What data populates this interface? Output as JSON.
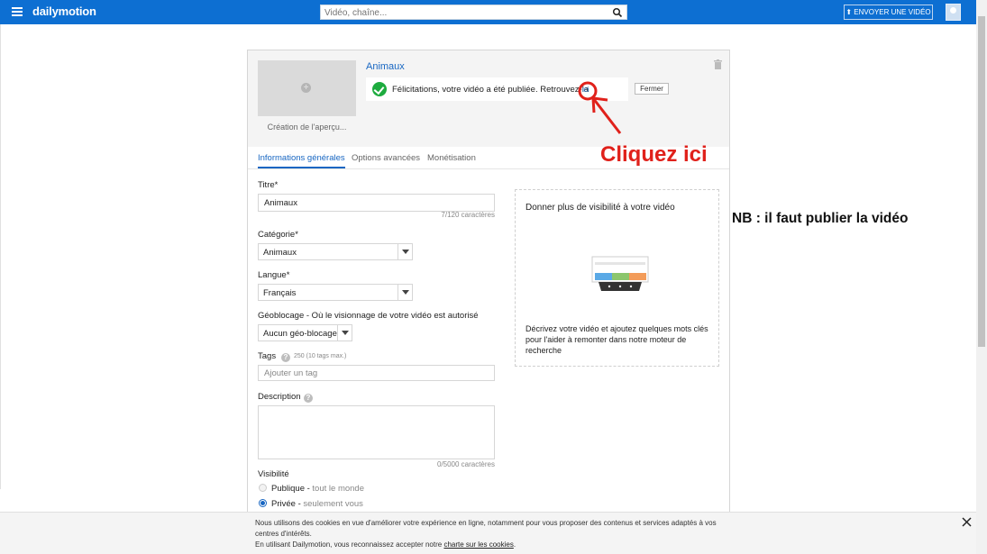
{
  "header": {
    "brand": "dailymotion",
    "search_placeholder": "Vidéo, chaîne...",
    "upload_label": "⬆ ENVOYER UNE VIDÉO"
  },
  "video": {
    "title": "Animaux",
    "thumbnail_caption": "Création de l'aperçu...",
    "notice_text": "Félicitations, votre vidéo a été publiée. Retrouvez-la",
    "notice_link": "ici",
    "close_label": "Fermer"
  },
  "tabs": [
    {
      "label": "Informations générales",
      "active": true
    },
    {
      "label": "Options avancées",
      "active": false
    },
    {
      "label": "Monétisation",
      "active": false
    }
  ],
  "form": {
    "title_label": "Titre*",
    "title_value": "Animaux",
    "title_counter": "7/120 caractères",
    "category_label": "Catégorie*",
    "category_value": "Animaux",
    "language_label": "Langue*",
    "language_value": "Français",
    "geoblock_label": "Géoblocage - Où le visionnage de votre vidéo est autorisé",
    "geoblock_value": "Aucun géo-blocage",
    "tags_label": "Tags",
    "tags_hint": "250 (10 tags max.)",
    "tags_placeholder": "Ajouter un tag",
    "description_label": "Description",
    "description_counter": "0/5000 caractères",
    "visibility_label": "Visibilité",
    "visibility_options": [
      {
        "label": "Publique -",
        "sub": "tout le monde",
        "selected": false
      },
      {
        "label": "Privée -",
        "sub": "seulement vous",
        "selected": true
      }
    ]
  },
  "promo": {
    "title": "Donner plus de visibilité à votre vidéo",
    "text": "Décrivez votre vidéo et ajoutez quelques mots clés pour l'aider à remonter dans notre moteur de recherche"
  },
  "annotations": {
    "cliquez": "Cliquez ici",
    "nb": "NB : il faut publier la vidéo"
  },
  "cookie": {
    "line1": "Nous utilisons des cookies en vue d'améliorer votre expérience en ligne, notamment pour vous proposer des contenus et services adaptés à vos centres d'intérêts.",
    "line2_prefix": "En utilisant Dailymotion, vous reconnaissez accepter notre",
    "link": "charte sur les cookies",
    "line2_suffix": "."
  },
  "colors": {
    "brand_blue": "#0d6fd2",
    "link_blue": "#1766c2",
    "success_green": "#1dab3e",
    "annotation_red": "#e0211b"
  }
}
